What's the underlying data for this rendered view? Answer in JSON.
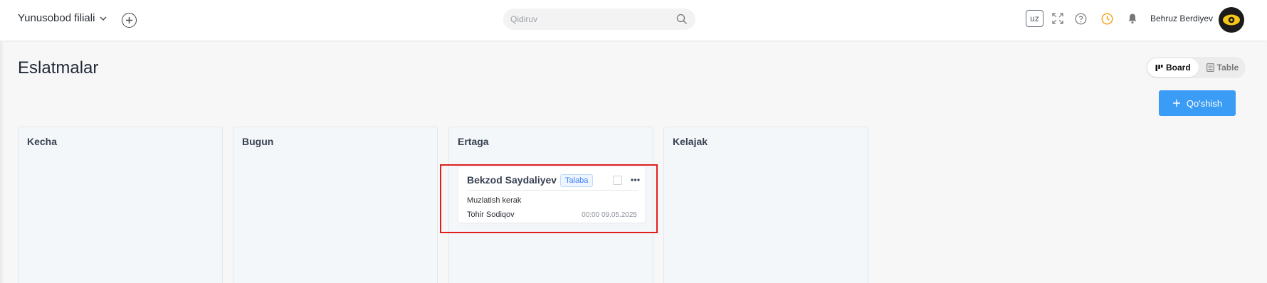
{
  "header": {
    "branch": "Yunusobod filiali",
    "search_placeholder": "Qidiruv",
    "language": "uz",
    "user_name": "Behruz Berdiyev"
  },
  "page": {
    "title": "Eslatmalar",
    "view_board": "Board",
    "view_table": "Table",
    "add_button": "Qo'shish"
  },
  "columns": [
    {
      "title": "Kecha"
    },
    {
      "title": "Bugun"
    },
    {
      "title": "Ertaga"
    },
    {
      "title": "Kelajak"
    }
  ],
  "card": {
    "name": "Bekzod Saydaliyev",
    "tag": "Talaba",
    "description": "Muzlatish kerak",
    "author": "Tohir Sodiqov",
    "datetime": "00:00 09.05.2025"
  },
  "colors": {
    "accent": "#3b9cf5",
    "highlight": "#e11d1d",
    "clock_icon": "#f59e0b"
  }
}
